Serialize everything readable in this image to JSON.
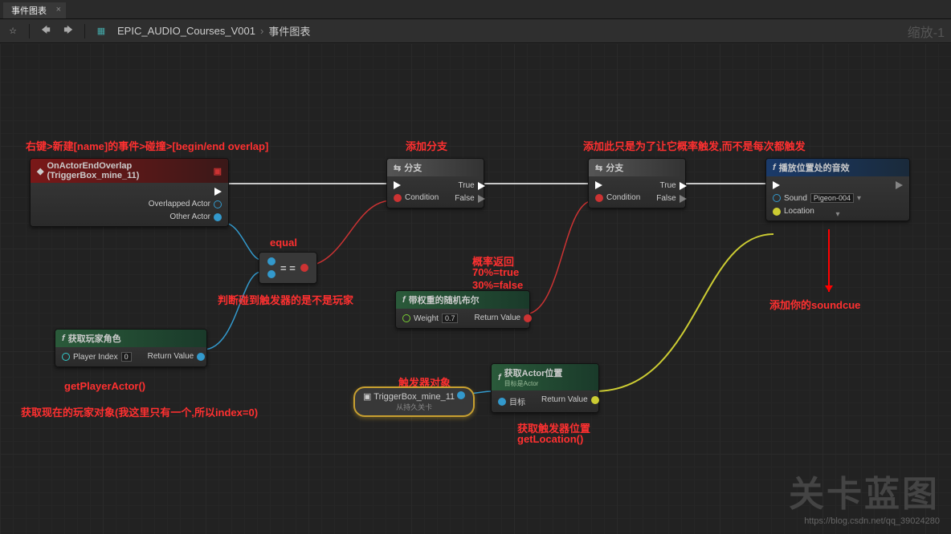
{
  "tab": {
    "title": "事件图表",
    "close": "×"
  },
  "toolbar": {
    "breadcrumb_root": "EPIC_AUDIO_Courses_V001",
    "breadcrumb_sep": "›",
    "breadcrumb_leaf": "事件图表",
    "zoom": "缩放-1"
  },
  "nodes": {
    "overlap": {
      "title": "OnActorEndOverlap (TriggerBox_mine_11)",
      "overlapped": "Overlapped Actor",
      "other": "Other Actor"
    },
    "branch1": {
      "title": "分支",
      "cond": "Condition",
      "true": "True",
      "false": "False"
    },
    "branch2": {
      "title": "分支",
      "cond": "Condition",
      "true": "True",
      "false": "False"
    },
    "equal": {
      "op": "= ="
    },
    "playsound": {
      "title": "播放位置处的音效",
      "sound": "Sound",
      "sound_val": "Pigeon-004",
      "location": "Location"
    },
    "randbool": {
      "title": "带权重的随机布尔",
      "weight": "Weight",
      "weight_val": "0.7",
      "return": "Return Value"
    },
    "getplayer": {
      "title": "获取玩家角色",
      "index": "Player Index",
      "index_val": "0",
      "return": "Return Value"
    },
    "ref": {
      "title": "TriggerBox_mine_11",
      "sub": "从持久关卡"
    },
    "getloc": {
      "title": "获取Actor位置",
      "sub": "目标是Actor",
      "target": "目标",
      "return": "Return Value"
    }
  },
  "annotations": {
    "a1": "右键>新建[name]的事件>碰撞>[begin/end overlap]",
    "a2": "添加分支",
    "a3": "添加此只是为了让它概率触发,而不是每次都触发",
    "a4": "equal",
    "a5": "判断碰到触发器的是不是玩家",
    "a6": "概率返回",
    "a7": "70%=true",
    "a8": "30%=false",
    "a9": "添加你的soundcue",
    "a10": "getPlayerActor()",
    "a11": "获取现在的玩家对象(我这里只有一个,所以index=0)",
    "a12": "触发器对象",
    "a13": "获取触发器位置",
    "a14": "getLocation()"
  },
  "watermark": {
    "big": "关卡蓝图",
    "url": "https://blog.csdn.net/qq_39024280"
  }
}
